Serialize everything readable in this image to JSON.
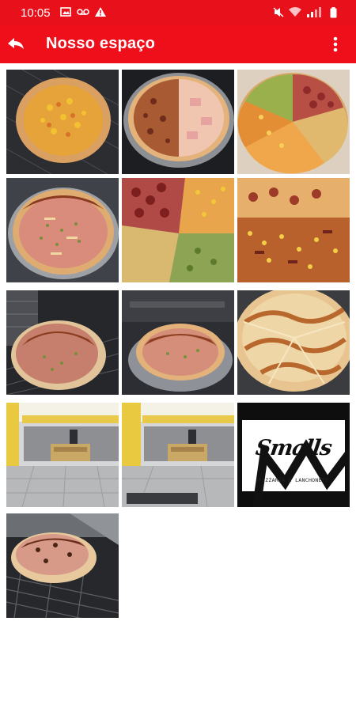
{
  "status_bar": {
    "time": "10:05",
    "left_icons": [
      "image-icon",
      "voicemail-icon",
      "warning-icon"
    ],
    "right_icons": [
      "mute-icon",
      "wifi-icon",
      "signal-icon",
      "battery-icon"
    ]
  },
  "app_bar": {
    "title": "Nosso espaço",
    "back_icon": "back-arrow-icon",
    "menu_icon": "more-vert-icon",
    "color": "#ef0f1a"
  },
  "gallery": {
    "photos": [
      {
        "subject": "pizza with corn topping"
      },
      {
        "subject": "half pepperoni half ham pizza"
      },
      {
        "subject": "pizza with mixed toppings slices"
      },
      {
        "subject": "ham and oregano pizza"
      },
      {
        "subject": "pizza with sausage, corn and vegetables"
      },
      {
        "subject": "pizza with corn and pepperoni"
      },
      {
        "subject": "pizza on oven rack"
      },
      {
        "subject": "pizza on metal tray"
      },
      {
        "subject": "chicken and catupiry pizza"
      },
      {
        "subject": "restaurant interior"
      },
      {
        "subject": "restaurant interior"
      },
      {
        "subject": "logo"
      },
      {
        "subject": "pizza in oven"
      }
    ],
    "logo": {
      "name": "Smalls",
      "subtitle": "PIZZARIA E LANCHONETE"
    }
  }
}
